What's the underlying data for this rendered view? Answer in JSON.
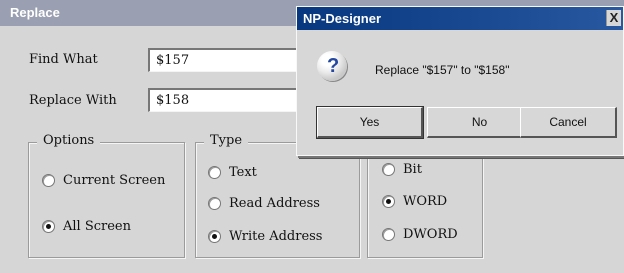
{
  "replace_window": {
    "title": "Replace",
    "find_label": "Find What",
    "find_value": "$157",
    "replace_label": "Replace With",
    "replace_value": "$158",
    "options_legend": "Options",
    "options": [
      "Current Screen",
      "All Screen"
    ],
    "options_selected": "All Screen",
    "type_legend": "Type",
    "types": [
      "Text",
      "Read Address",
      "Write Address"
    ],
    "type_selected": "Write Address",
    "sizes": [
      "Bit",
      "WORD",
      "DWORD"
    ],
    "size_selected": "WORD"
  },
  "dialog": {
    "title": "NP-Designer",
    "close_label": "X",
    "message": "Replace \"$157\" to \"$158\"",
    "buttons": {
      "yes": "Yes",
      "no": "No",
      "cancel": "Cancel"
    },
    "icon": "question-icon"
  },
  "colors": {
    "background": "#d6d6d6",
    "replace_titlebar": "#9aa0b2",
    "dialog_titlebar": "#07377f"
  }
}
